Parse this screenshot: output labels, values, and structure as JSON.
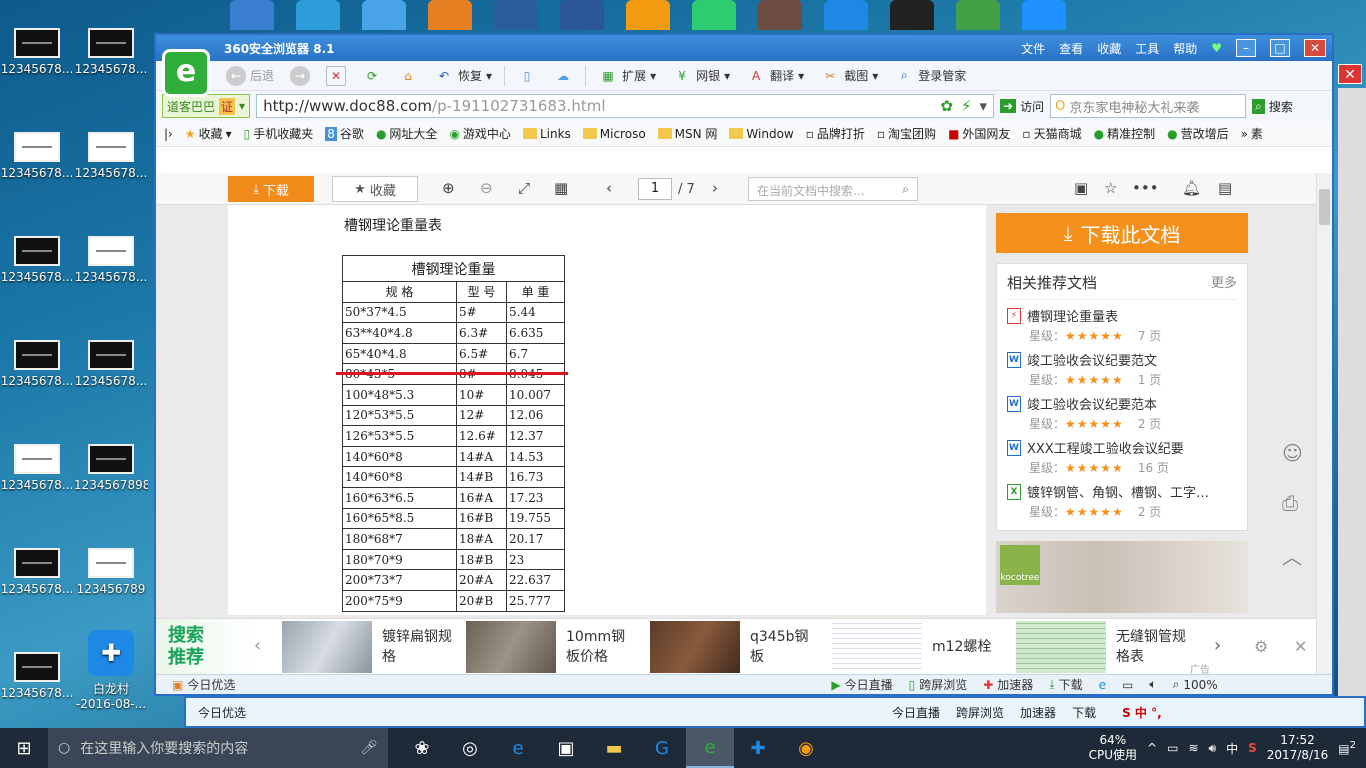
{
  "desktop": {
    "icons": [
      {
        "label": "12345678..."
      },
      {
        "label": "12345678..."
      },
      {
        "label": "12345678..."
      },
      {
        "label": "12345678..."
      },
      {
        "label": "12345678..."
      },
      {
        "label": "12345678..."
      },
      {
        "label": "12345678..."
      },
      {
        "label": "12345678..."
      },
      {
        "label": "12345678..."
      },
      {
        "label": "1234567898"
      },
      {
        "label": "12345678..."
      },
      {
        "label": "123456789"
      },
      {
        "label": "12345678..."
      },
      {
        "label": "白龙村 -2016-08-..."
      }
    ]
  },
  "browser": {
    "title": "360安全浏览器 8.1",
    "menu": [
      "文件",
      "查看",
      "收藏",
      "工具",
      "帮助"
    ],
    "toolbar": {
      "back": "后退",
      "restore": "恢复",
      "extend": "扩展",
      "bank": "网银",
      "translate": "翻译",
      "screenshot": "截图",
      "login": "登录管家"
    },
    "address": {
      "prefix": "道客巴巴",
      "url_host": "http://www.doc88.com",
      "url_path": "/p-191102731683.html",
      "visit": "访问",
      "search_placeholder": "京东家电神秘大礼来袭",
      "search_btn": "搜索"
    },
    "favorites": [
      "收藏",
      "手机收藏夹",
      "谷歌",
      "网址大全",
      "游戏中心",
      "Links",
      "Microso",
      "MSN 网",
      "Window",
      "品牌打折",
      "淘宝团购",
      "外国网友",
      "天猫商城",
      "精准控制",
      "营改增后"
    ],
    "fav_more": "素",
    "status": {
      "left": "今日优选",
      "items": [
        "今日直播",
        "跨屏浏览",
        "加速器",
        "下载"
      ],
      "zoom": "100%"
    }
  },
  "doc": {
    "download": "下载",
    "favorite": "收藏",
    "page_current": "1",
    "page_total": "/ 7",
    "search_placeholder": "在当前文档中搜索...",
    "heading": "槽钢理论重量表",
    "table_caption": "槽钢理论重量",
    "headers": [
      "规  格",
      "型 号",
      "单 重"
    ],
    "rows": [
      [
        "50*37*4.5",
        "5#",
        "5.44"
      ],
      [
        "63**40*4.8",
        "6.3#",
        "6.635"
      ],
      [
        "65*40*4.8",
        "6.5#",
        "6.7"
      ],
      [
        "80*43*5",
        "8#",
        "8.045"
      ],
      [
        "100*48*5.3",
        "10#",
        "10.007"
      ],
      [
        "120*53*5.5",
        "12#",
        "12.06"
      ],
      [
        "126*53*5.5",
        "12.6#",
        "12.37"
      ],
      [
        "140*60*8",
        "14#A",
        "14.53"
      ],
      [
        "140*60*8",
        "14#B",
        "16.73"
      ],
      [
        "160*63*6.5",
        "16#A",
        "17.23"
      ],
      [
        "160*65*8.5",
        "16#B",
        "19.755"
      ],
      [
        "180*68*7",
        "18#A",
        "20.17"
      ],
      [
        "180*70*9",
        "18#B",
        "23"
      ],
      [
        "200*73*7",
        "20#A",
        "22.637"
      ],
      [
        "200*75*9",
        "20#B",
        "25.777"
      ]
    ]
  },
  "sidebar": {
    "download_doc": "下载此文档",
    "related_title": "相关推荐文档",
    "more": "更多",
    "items": [
      {
        "title": "槽钢理论重量表",
        "type": "pdf",
        "rating_label": "星级：",
        "stars": "★★★★★",
        "pages": "7 页"
      },
      {
        "title": "竣工验收会议纪要范文",
        "type": "w",
        "rating_label": "星级：",
        "stars": "★★★★★",
        "pages": "1 页"
      },
      {
        "title": "竣工验收会议纪要范本",
        "type": "w",
        "rating_label": "星级：",
        "stars": "★★★★★",
        "pages": "2 页"
      },
      {
        "title": "XXX工程竣工验收会议纪要",
        "type": "w",
        "rating_label": "星级：",
        "stars": "★★★★★",
        "pages": "16 页"
      },
      {
        "title": "镀锌钢管、角钢、槽钢、工字…",
        "type": "x",
        "rating_label": "星级：",
        "stars": "★★★★★",
        "pages": "2 页"
      }
    ],
    "ad_brand": "kocotree"
  },
  "recommend": {
    "label_line1": "搜索",
    "label_line2": "推荐",
    "items": [
      {
        "text": "镀锌扁钢规格"
      },
      {
        "text": "10mm钢板价格"
      },
      {
        "text": "q345b钢板"
      },
      {
        "text": "m12螺栓"
      },
      {
        "text": "无缝钢管规格表"
      }
    ],
    "ad_tag": "广告"
  },
  "back_window": {
    "left": "今日优选",
    "items": [
      "今日直播",
      "跨屏浏览",
      "加速器",
      "下载"
    ]
  },
  "taskbar": {
    "search_placeholder": "在这里输入你要搜索的内容",
    "cpu_percent": "64%",
    "cpu_label": "CPU使用",
    "ime": "中",
    "time": "17:52",
    "date": "2017/8/16",
    "notifications": "2"
  },
  "colors": {
    "accent_orange": "#f5901c",
    "window_blue": "#2a72c7",
    "green": "#1aa35a",
    "red_line": "#e0141e"
  }
}
